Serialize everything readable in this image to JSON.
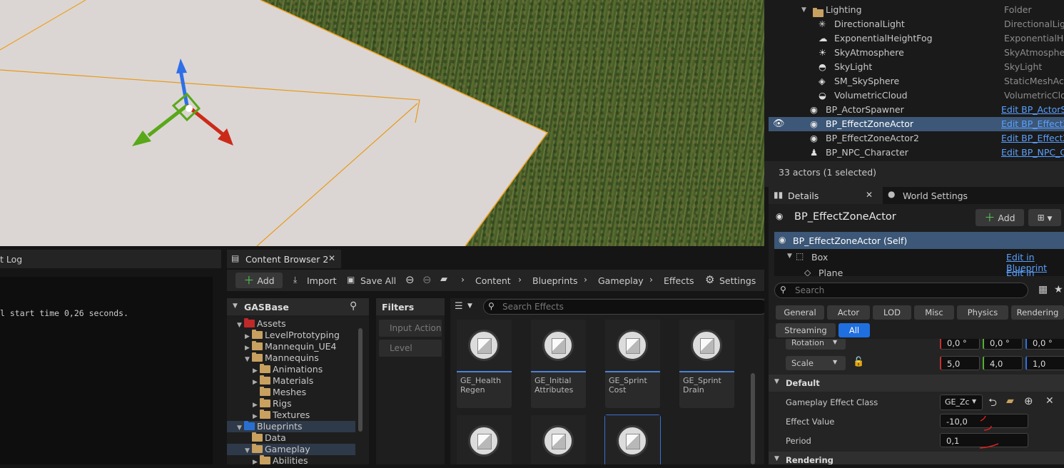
{
  "outliner": {
    "rows": [
      {
        "name": "Lighting",
        "type": "Folder"
      },
      {
        "name": "DirectionalLight",
        "type": "DirectionalLight"
      },
      {
        "name": "ExponentialHeightFog",
        "type": "ExponentialHeig"
      },
      {
        "name": "SkyAtmosphere",
        "type": "SkyAtmosphere"
      },
      {
        "name": "SkyLight",
        "type": "SkyLight"
      },
      {
        "name": "SM_SkySphere",
        "type": "StaticMeshActo"
      },
      {
        "name": "VolumetricCloud",
        "type": "VolumetricClouc"
      },
      {
        "name": "BP_ActorSpawner",
        "type": "Edit BP_ActorSp"
      },
      {
        "name": "BP_EffectZoneActor",
        "type": "Edit BP_EffectZ"
      },
      {
        "name": "BP_EffectZoneActor2",
        "type": "Edit BP_EffectZ"
      },
      {
        "name": "BP_NPC_Character",
        "type": "Edit BP_NPC_Ch"
      }
    ],
    "status": "33 actors (1 selected)"
  },
  "details": {
    "tabs": {
      "details": "Details",
      "world_settings": "World Settings"
    },
    "actor_name": "BP_EffectZoneActor",
    "add_label": "Add",
    "components": [
      {
        "name": "BP_EffectZoneActor (Self)",
        "link": ""
      },
      {
        "name": "Box",
        "link": "Edit in Blueprint"
      },
      {
        "name": "Plane",
        "link": "Edit in Blueprint"
      }
    ],
    "search_placeholder": "Search",
    "categories_row1": [
      "General",
      "Actor",
      "LOD",
      "Misc",
      "Physics",
      "Rendering"
    ],
    "categories_row2": [
      "Streaming",
      "All"
    ],
    "rotation": {
      "label": "Rotation",
      "x": "0,0 °",
      "y": "0,0 °",
      "z": "0,0 °"
    },
    "scale": {
      "label": "Scale",
      "x": "5,0",
      "y": "4,0",
      "z": "1,0"
    },
    "default_section": "Default",
    "gameplay_effect_class": {
      "label": "Gameplay Effect Class",
      "value": "GE_Zc"
    },
    "effect_value": {
      "label": "Effect Value",
      "value": "-10,0"
    },
    "period": {
      "label": "Period",
      "value": "0,1"
    },
    "rendering_section": "Rendering"
  },
  "output_log": {
    "tab": "t Log",
    "line": "l start time 0,26 seconds."
  },
  "content_browser": {
    "tab": "Content Browser 2",
    "add_label": "Add",
    "import_label": "Import",
    "save_all_label": "Save All",
    "breadcrumb": [
      "Content",
      "Blueprints",
      "Gameplay",
      "Effects"
    ],
    "settings_label": "Settings",
    "root": "GASBase",
    "tree": [
      {
        "label": "Assets",
        "depth": 1,
        "open": true,
        "color": "red"
      },
      {
        "label": "LevelPrototyping",
        "depth": 2,
        "open": false,
        "color": "tan"
      },
      {
        "label": "Mannequin_UE4",
        "depth": 2,
        "open": false,
        "color": "tan"
      },
      {
        "label": "Mannequins",
        "depth": 2,
        "open": true,
        "color": "tan"
      },
      {
        "label": "Animations",
        "depth": 3,
        "open": false,
        "color": "tan"
      },
      {
        "label": "Materials",
        "depth": 3,
        "open": false,
        "color": "tan"
      },
      {
        "label": "Meshes",
        "depth": 3,
        "open": null,
        "color": "tan"
      },
      {
        "label": "Rigs",
        "depth": 3,
        "open": false,
        "color": "tan"
      },
      {
        "label": "Textures",
        "depth": 3,
        "open": false,
        "color": "tan"
      },
      {
        "label": "Blueprints",
        "depth": 1,
        "open": true,
        "color": "blue"
      },
      {
        "label": "Data",
        "depth": 2,
        "open": null,
        "color": "tan"
      },
      {
        "label": "Gameplay",
        "depth": 2,
        "open": true,
        "color": "tan"
      },
      {
        "label": "Abilities",
        "depth": 3,
        "open": false,
        "color": "tan"
      }
    ],
    "filters_label": "Filters",
    "filter_items": [
      "Input Action",
      "Level"
    ],
    "search_placeholder": "Search Effects",
    "assets": [
      {
        "line1": "GE_Health",
        "line2": "Regen"
      },
      {
        "line1": "GE_Initial",
        "line2": "Attributes"
      },
      {
        "line1": "GE_Sprint",
        "line2": "Cost"
      },
      {
        "line1": "GE_Sprint",
        "line2": "Drain"
      }
    ]
  }
}
